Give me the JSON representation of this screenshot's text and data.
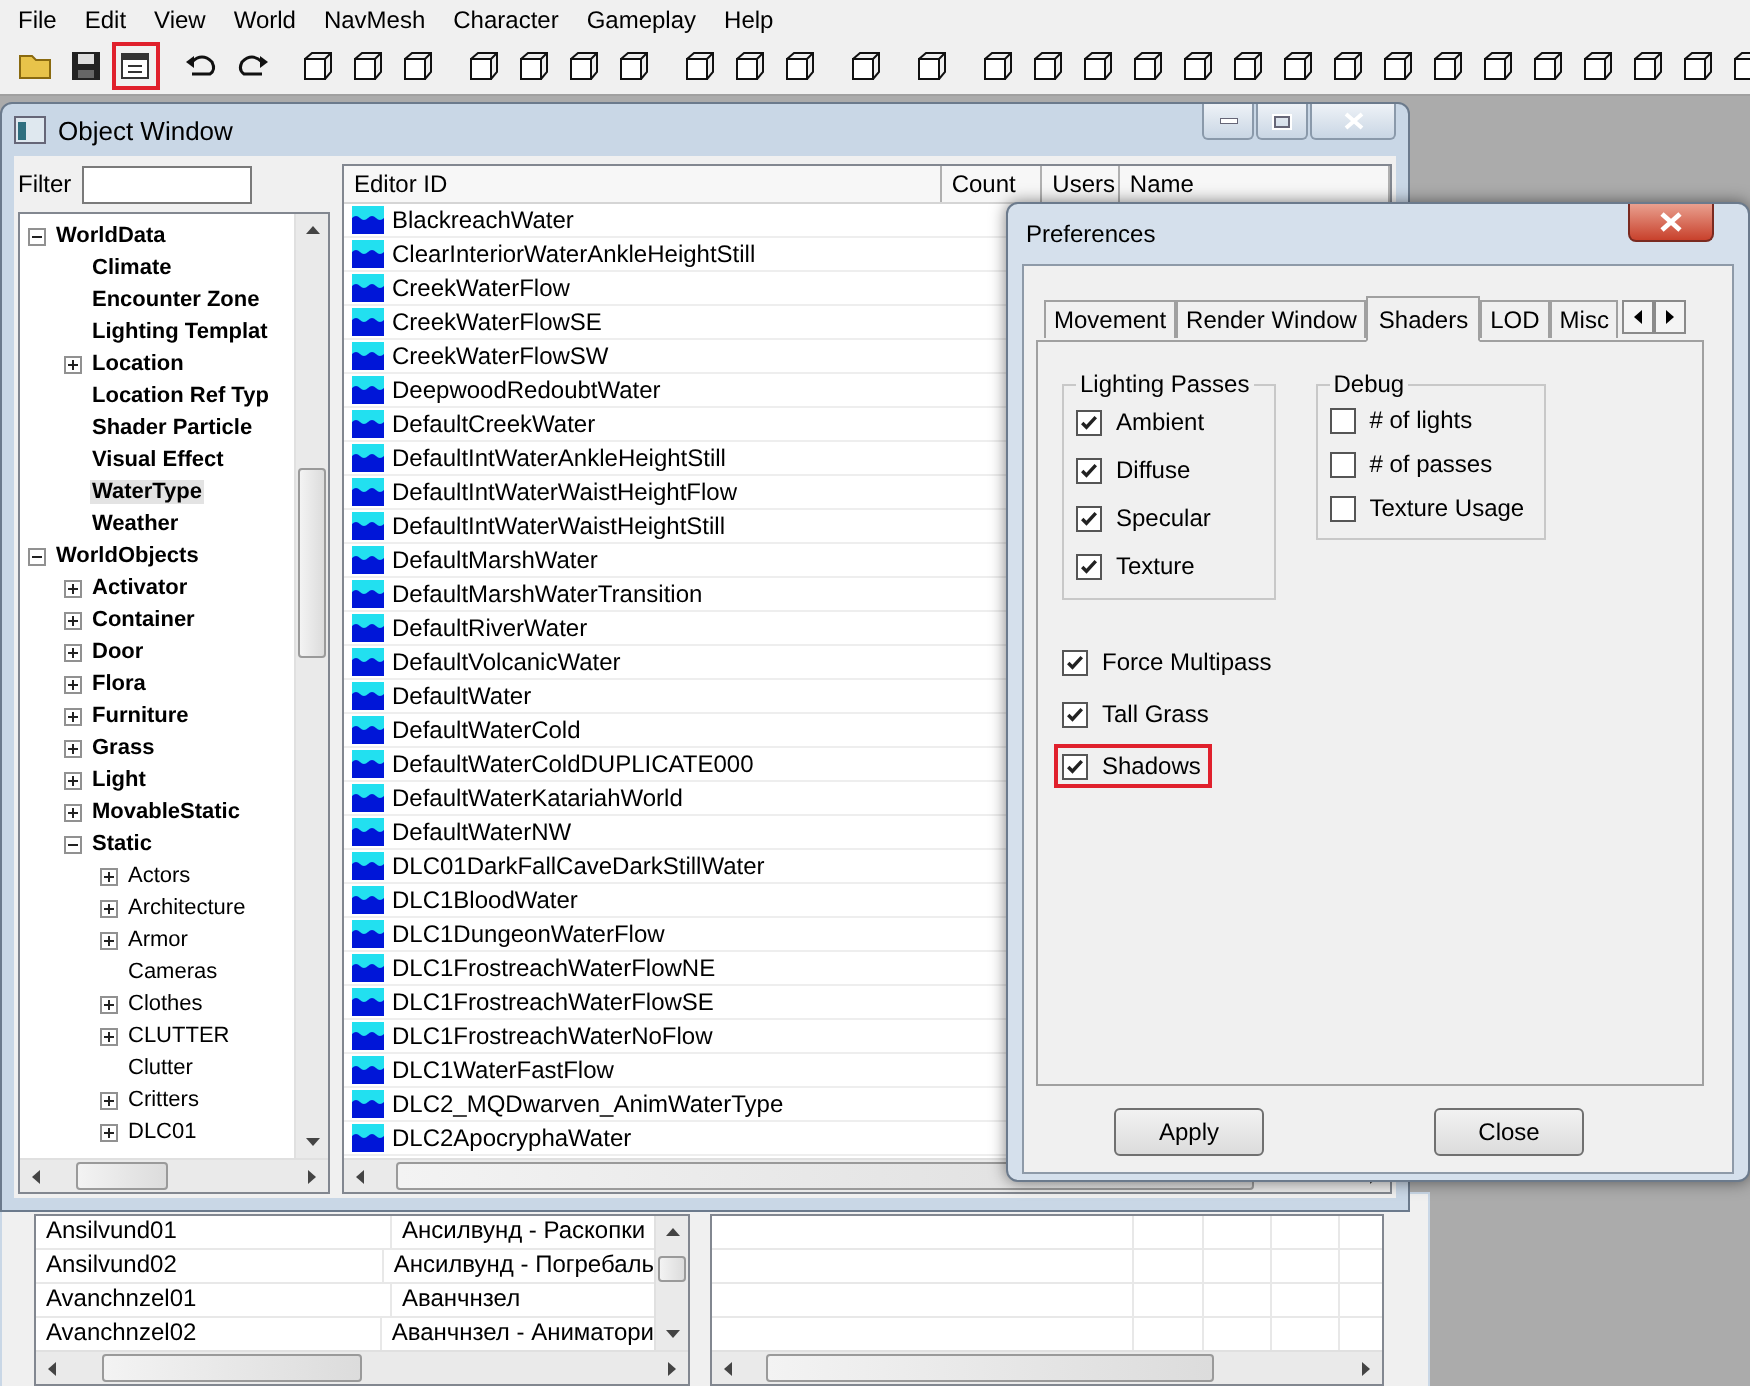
{
  "menu": [
    "File",
    "Edit",
    "View",
    "World",
    "NavMesh",
    "Character",
    "Gameplay",
    "Help"
  ],
  "toolbar_groups": [
    {
      "buttons": [
        {
          "kind": "folder",
          "highlighted": false
        },
        {
          "kind": "disk",
          "highlighted": false
        },
        {
          "kind": "properties",
          "highlighted": true
        }
      ]
    },
    {
      "buttons": [
        {
          "kind": "undo",
          "highlighted": false
        },
        {
          "kind": "redo",
          "highlighted": false
        }
      ]
    },
    {
      "buttons": [
        {
          "kind": "tool",
          "highlighted": false
        },
        {
          "kind": "tool",
          "highlighted": false
        },
        {
          "kind": "tool",
          "highlighted": false
        }
      ]
    },
    {
      "buttons": [
        {
          "kind": "tool",
          "highlighted": false
        },
        {
          "kind": "tool",
          "highlighted": false
        },
        {
          "kind": "tool",
          "highlighted": false
        },
        {
          "kind": "tool",
          "highlighted": false
        }
      ]
    },
    {
      "buttons": [
        {
          "kind": "tool",
          "highlighted": false
        },
        {
          "kind": "tool",
          "highlighted": false
        },
        {
          "kind": "tool",
          "highlighted": false
        }
      ]
    },
    {
      "buttons": [
        {
          "kind": "tool",
          "highlighted": false
        }
      ]
    },
    {
      "buttons": [
        {
          "kind": "tool",
          "highlighted": false
        }
      ]
    },
    {
      "buttons": [
        {
          "kind": "tool",
          "highlighted": false
        },
        {
          "kind": "tool",
          "highlighted": false
        },
        {
          "kind": "tool",
          "highlighted": false
        },
        {
          "kind": "tool",
          "highlighted": false
        },
        {
          "kind": "tool",
          "highlighted": false
        },
        {
          "kind": "tool",
          "highlighted": false
        },
        {
          "kind": "tool",
          "highlighted": false
        },
        {
          "kind": "tool",
          "highlighted": false
        },
        {
          "kind": "tool",
          "highlighted": false
        },
        {
          "kind": "tool",
          "highlighted": false
        },
        {
          "kind": "tool",
          "highlighted": false
        },
        {
          "kind": "tool",
          "highlighted": false
        },
        {
          "kind": "tool",
          "highlighted": false
        },
        {
          "kind": "tool",
          "highlighted": false
        },
        {
          "kind": "tool",
          "highlighted": false
        },
        {
          "kind": "tool",
          "highlighted": false
        }
      ]
    }
  ],
  "bottom_window": {
    "rows": [
      {
        "id": "Ansilvund01",
        "name": "Ансилвунд - Раскопки"
      },
      {
        "id": "Ansilvund02",
        "name": "Ансилвунд - Погребаль"
      },
      {
        "id": "Avanchnzel01",
        "name": "Аванчнзел"
      },
      {
        "id": "Avanchnzel02",
        "name": "Аванчнзел - Аниматори"
      }
    ]
  },
  "object_window": {
    "title": "Object Window",
    "filter": {
      "label": "Filter"
    },
    "tree": [
      {
        "label": "WorldData",
        "kind": "branch",
        "expanded": true,
        "selected": false,
        "children": [
          {
            "label": "Climate",
            "kind": "leaf",
            "selected": false
          },
          {
            "label": "Encounter Zone",
            "kind": "leaf",
            "selected": false
          },
          {
            "label": "Lighting Templat",
            "kind": "leaf",
            "selected": false
          },
          {
            "label": "Location",
            "kind": "branch",
            "expanded": false,
            "selected": false
          },
          {
            "label": "Location Ref Typ",
            "kind": "leaf",
            "selected": false
          },
          {
            "label": "Shader Particle",
            "kind": "leaf",
            "selected": false
          },
          {
            "label": "Visual Effect",
            "kind": "leaf",
            "selected": false
          },
          {
            "label": "WaterType",
            "kind": "leaf",
            "selected": true
          },
          {
            "label": "Weather",
            "kind": "leaf",
            "selected": false
          }
        ]
      },
      {
        "label": "WorldObjects",
        "kind": "branch",
        "expanded": true,
        "selected": false,
        "children": [
          {
            "label": "Activator",
            "kind": "branch",
            "expanded": false,
            "selected": false
          },
          {
            "label": "Container",
            "kind": "branch",
            "expanded": false,
            "selected": false
          },
          {
            "label": "Door",
            "kind": "branch",
            "expanded": false,
            "selected": false
          },
          {
            "label": "Flora",
            "kind": "branch",
            "expanded": false,
            "selected": false
          },
          {
            "label": "Furniture",
            "kind": "branch",
            "expanded": false,
            "selected": false
          },
          {
            "label": "Grass",
            "kind": "branch",
            "expanded": false,
            "selected": false
          },
          {
            "label": "Light",
            "kind": "branch",
            "expanded": false,
            "selected": false
          },
          {
            "label": "MovableStatic",
            "kind": "branch",
            "expanded": false,
            "selected": false
          },
          {
            "label": "Static",
            "kind": "branch",
            "expanded": true,
            "selected": false,
            "children": [
              {
                "label": "Actors",
                "kind": "branch",
                "expanded": false,
                "selected": false
              },
              {
                "label": "Architecture",
                "kind": "branch",
                "expanded": false,
                "selected": false
              },
              {
                "label": "Armor",
                "kind": "branch",
                "expanded": false,
                "selected": false
              },
              {
                "label": "Cameras",
                "kind": "leaf",
                "selected": false
              },
              {
                "label": "Clothes",
                "kind": "branch",
                "expanded": false,
                "selected": false
              },
              {
                "label": "CLUTTER",
                "kind": "branch",
                "expanded": false,
                "selected": false
              },
              {
                "label": "Clutter",
                "kind": "leaf",
                "selected": false
              },
              {
                "label": "Critters",
                "kind": "branch",
                "expanded": false,
                "selected": false
              },
              {
                "label": "DLC01",
                "kind": "branch",
                "expanded": false,
                "selected": false
              }
            ]
          }
        ]
      }
    ],
    "list": {
      "columns": [
        "Editor ID",
        "Count",
        "Users",
        "Name"
      ],
      "rows": [
        "BlackreachWater",
        "ClearInteriorWaterAnkleHeightStill",
        "CreekWaterFlow",
        "CreekWaterFlowSE",
        "CreekWaterFlowSW",
        "DeepwoodRedoubtWater",
        "DefaultCreekWater",
        "DefaultIntWaterAnkleHeightStill",
        "DefaultIntWaterWaistHeightFlow",
        "DefaultIntWaterWaistHeightStill",
        "DefaultMarshWater",
        "DefaultMarshWaterTransition",
        "DefaultRiverWater",
        "DefaultVolcanicWater",
        "DefaultWater",
        "DefaultWaterCold",
        "DefaultWaterColdDUPLICATE000",
        "DefaultWaterKatariahWorld",
        "DefaultWaterNW",
        "DLC01DarkFallCaveDarkStillWater",
        "DLC1BloodWater",
        "DLC1DungeonWaterFlow",
        "DLC1FrostreachWaterFlowNE",
        "DLC1FrostreachWaterFlowSE",
        "DLC1FrostreachWaterNoFlow",
        "DLC1WaterFastFlow",
        "DLC2_MQDwarven_AnimWaterType",
        "DLC2ApocryphaWater"
      ]
    }
  },
  "preferences": {
    "title": "Preferences",
    "tabs": [
      {
        "label": "Movement",
        "selected": false
      },
      {
        "label": "Render Window",
        "selected": false
      },
      {
        "label": "Shaders",
        "selected": true
      },
      {
        "label": "LOD",
        "selected": false
      },
      {
        "label": "Misc",
        "selected": false
      }
    ],
    "groups": [
      {
        "title": "Lighting Passes",
        "options": [
          {
            "label": "Ambient",
            "checked": true
          },
          {
            "label": "Diffuse",
            "checked": true
          },
          {
            "label": "Specular",
            "checked": true
          },
          {
            "label": "Texture",
            "checked": true
          }
        ]
      },
      {
        "title": "Debug",
        "options": [
          {
            "label": "# of lights",
            "checked": false
          },
          {
            "label": "# of passes",
            "checked": false
          },
          {
            "label": "Texture Usage",
            "checked": false
          }
        ]
      }
    ],
    "options": [
      {
        "label": "Force Multipass",
        "checked": true,
        "highlighted": false
      },
      {
        "label": "Tall Grass",
        "checked": true,
        "highlighted": false
      },
      {
        "label": "Shadows",
        "checked": true,
        "highlighted": true
      }
    ],
    "buttons": [
      "Apply",
      "Close"
    ]
  }
}
